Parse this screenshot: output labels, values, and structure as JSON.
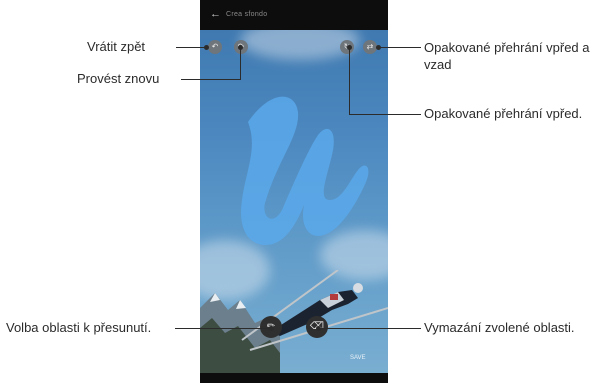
{
  "phone": {
    "top_bar_title": "Crea sfondo",
    "back_icon": "back-arrow-icon",
    "save_label": "SAVE"
  },
  "icons": {
    "undo": "undo-icon",
    "redo": "redo-icon",
    "repeat_forward": "repeat-icon",
    "repeat_back_forth": "loop-icon",
    "move_selection": "brush-icon",
    "erase_selection": "eraser-icon"
  },
  "callouts": {
    "undo": "Vrátit zpět",
    "redo": "Provést znovu",
    "repeat_back_forth_line1": "Opakované přehrání vpřed a",
    "repeat_back_forth_line2": "vzad",
    "repeat_forward": "Opakované přehrání vpřed.",
    "move_area": "Volba oblasti k přesunutí.",
    "erase_area": "Vymazání zvolené oblasti."
  },
  "colors": {
    "sky": "#5b97c7",
    "paint": "#5aa8ea",
    "callout_text": "#2b2b2b"
  }
}
